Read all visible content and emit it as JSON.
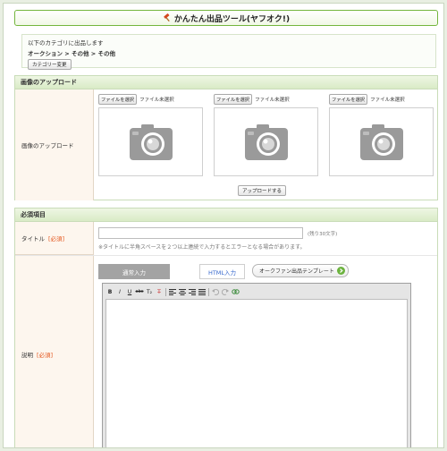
{
  "header": {
    "title": "かんたん出品ツール(ヤフオク!)"
  },
  "category": {
    "intro": "以下のカテゴリに出品します",
    "path": "オークション > その他 > その他",
    "change_button": "カテゴリー変更"
  },
  "upload": {
    "section_title": "画像のアップロード",
    "row_label": "画像のアップロード",
    "slots": [
      {
        "button": "ファイルを選択",
        "status": "ファイル未選択"
      },
      {
        "button": "ファイルを選択",
        "status": "ファイル未選択"
      },
      {
        "button": "ファイルを選択",
        "status": "ファイル未選択"
      }
    ],
    "upload_button": "アップロードする"
  },
  "required": {
    "section_title": "必須項目",
    "required_mark": "[必須]",
    "title_label": "タイトル",
    "title_value": "",
    "title_counter": "(残り30文字)",
    "title_note": "※タイトルに半角スペースを２つ以上連続で入力するとエラーとなる場合があります。",
    "desc_label": "説明",
    "tabs": {
      "normal": "通常入力",
      "html": "HTML入力"
    },
    "template_button": "オークファン出品テンプレート",
    "toolbar": {
      "bold": "B",
      "italic": "I",
      "underline": "U",
      "strike": "abc",
      "sub": "T₂",
      "clear": "T̶"
    }
  },
  "colors": {
    "accent_green": "#74b63e",
    "required_red": "#e3541b",
    "label_bg": "#fdf6ee"
  }
}
